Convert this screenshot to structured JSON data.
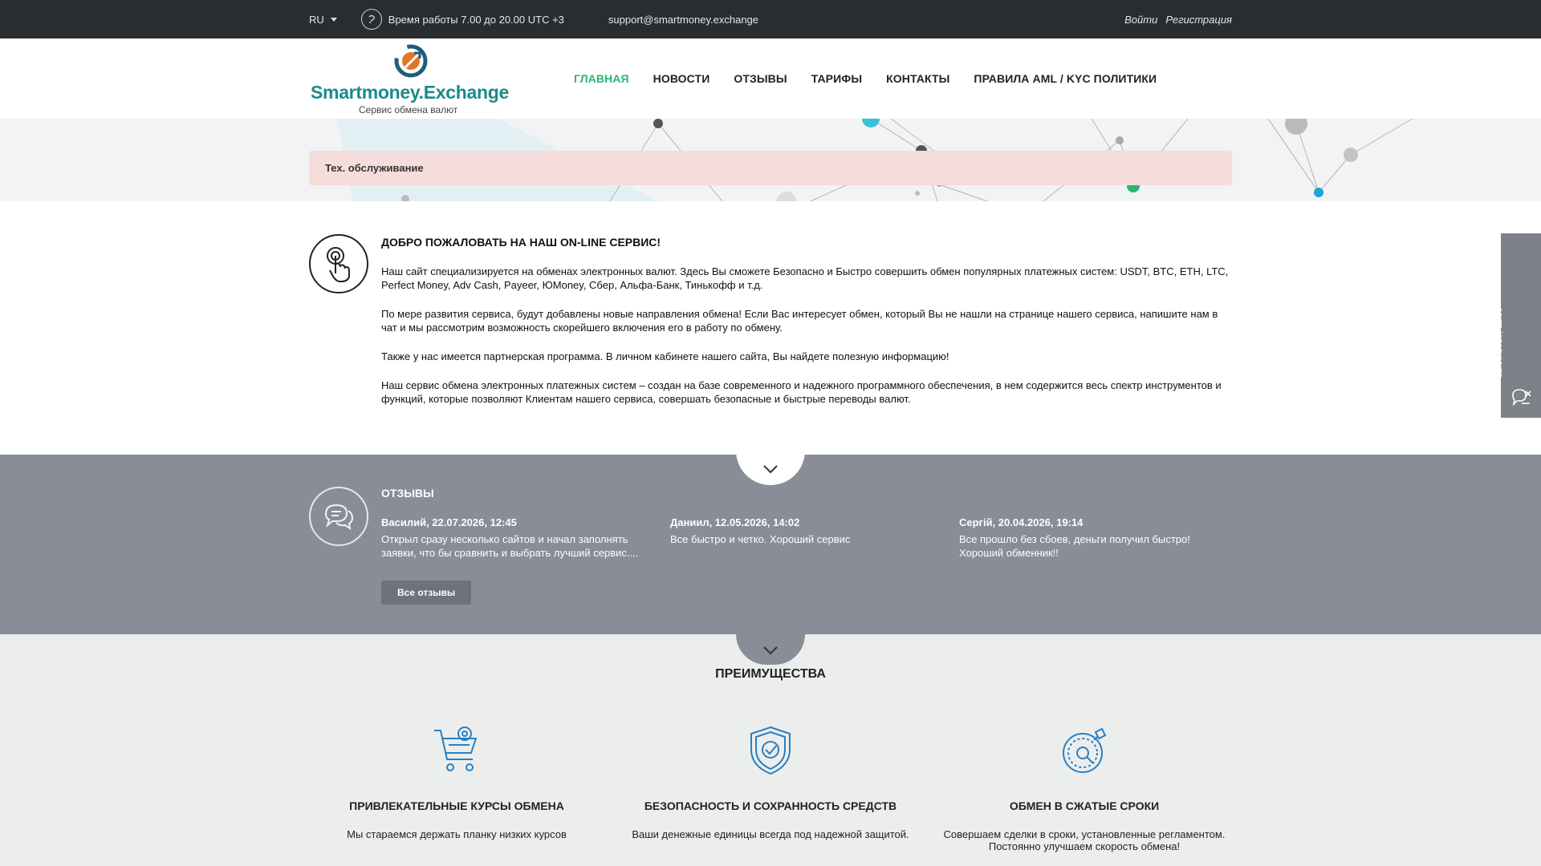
{
  "topbar": {
    "language": "RU",
    "hours": "Время работы 7.00 до 20.00 UTC +3",
    "email": "support@smartmoney.exchange",
    "login": "Войти",
    "register": "Регистрация"
  },
  "header": {
    "logo_title": "Smartmoney.Exchange",
    "logo_subtitle": "Сервис обмена валют",
    "nav": [
      {
        "label": "ГЛАВНАЯ",
        "active": true
      },
      {
        "label": "НОВОСТИ"
      },
      {
        "label": "ОТЗЫВЫ"
      },
      {
        "label": "ТАРИФЫ"
      },
      {
        "label": "КОНТАКТЫ"
      },
      {
        "label": "ПРАВИЛА AML / KYC ПОЛИТИКИ"
      }
    ]
  },
  "alert": "Тех. обслуживание",
  "welcome": {
    "title": "ДОБРО ПОЖАЛОВАТЬ НА НАШ ON-LINE СЕРВИС!",
    "paragraphs": [
      "Наш сайт специализируется на обменах электронных валют. Здесь Вы сможете Безопасно и Быстро совершить обмен популярных платежных систем: USDT, BTC, ETH, LTC, Perfect Money, Adv Cash, Payeer, ЮMoney, Сбер, Альфа-Банк, Тинькофф и т.д.",
      "По мере развития сервиса, будут добавлены новые направления обмена! Если Вас интересует обмен, который Вы не нашли на странице нашего сервиса, напишите нам в чат и мы рассмотрим возможность скорейшего включения его в работу по обмену.",
      "Также у нас имеется партнерская программа. В личном кабинете нашего сайта, Вы найдете полезную информацию!",
      "Наш сервис обмена электронных платежных систем – создан на базе современного и надежного программного обеспечения, в нем содержится весь спектр инструментов и функций, которые позволяют Клиентам нашего сервиса, совершать безопасные и быстрые переводы валют."
    ]
  },
  "reviews": {
    "title": "ОТЗЫВЫ",
    "items": [
      {
        "author": "Василий, 22.07.2026, 12:45",
        "text": "Открыл сразу несколько сайтов и начал заполнять заявки, что бы сравнить и выбрать лучший сервис...."
      },
      {
        "author": "Даниил, 12.05.2026, 14:02",
        "text": "Все быстро и четко. Хороший сервис"
      },
      {
        "author": "Сергій, 20.04.2026, 19:14",
        "text": "Все прошло без сбоев, деньги получил быстро! Хороший обменник!!"
      }
    ],
    "all_button": "Все отзывы"
  },
  "advantages": {
    "title": "ПРЕИМУЩЕСТВА",
    "items": [
      {
        "icon": "cart-icon",
        "name": "ПРИВЛЕКАТЕЛЬНЫЕ КУРСЫ ОБМЕНА",
        "desc": "Мы стараемся держать планку низких курсов"
      },
      {
        "icon": "shield-icon",
        "name": "БЕЗОПАСНОСТЬ И СОХРАННОСТЬ СРЕДСТВ",
        "desc": "Ваши денежные единицы всегда под надежной защитой."
      },
      {
        "icon": "stopwatch-icon",
        "name": "ОБМЕН В СЖАТЫЕ СРОКИ",
        "desc": "Совершаем сделки в сроки, установленные регламентом. Постоянно улучшаем скорость обмена!"
      }
    ]
  },
  "operator": {
    "title": "ОПЕРАТОР OFFLINE",
    "time": "12.08.2026, 11:59"
  },
  "colors": {
    "accent": "#2bb673",
    "topbar": "#2a2d2f",
    "reviews_bg": "#888d97",
    "alert_bg": "#f5dddc",
    "icon_blue": "#2a7fc0"
  }
}
